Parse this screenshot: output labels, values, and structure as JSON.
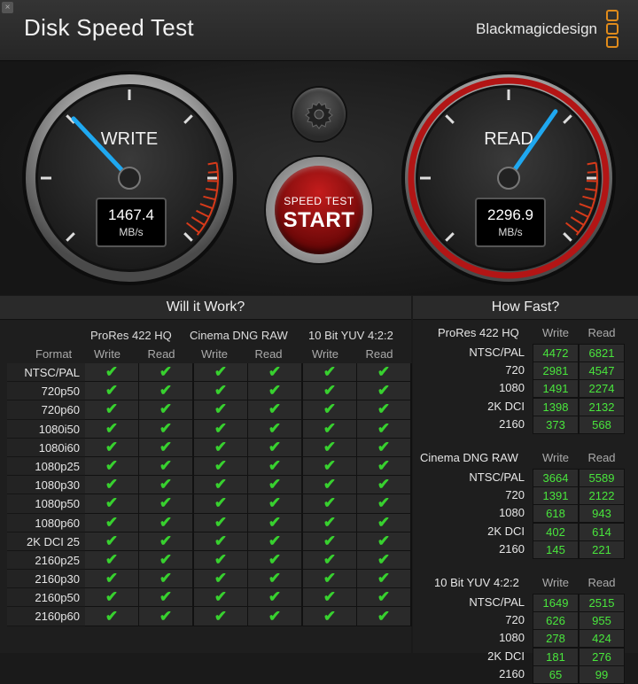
{
  "app": {
    "title": "Disk Speed Test",
    "brand": "Blackmagicdesign",
    "close_glyph": "×"
  },
  "gauges": {
    "write": {
      "label": "WRITE",
      "value": "1467.4",
      "unit": "MB/s",
      "needle_fraction": 0.34
    },
    "read": {
      "label": "READ",
      "value": "2296.9",
      "unit": "MB/s",
      "needle_fraction": 0.63
    }
  },
  "start_button": {
    "small": "SPEED TEST",
    "big": "START"
  },
  "icons": {
    "settings": "gear-icon",
    "check": "check-icon"
  },
  "colors": {
    "check": "#38d12f",
    "value": "#49e63c",
    "needle": "#1fa8f0",
    "read_ring": "#b31515",
    "redline": "#d63a1a",
    "brand_logo": "#e08b1b"
  },
  "will_it_work": {
    "title": "Will it Work?",
    "format_label": "Format",
    "groups": [
      "ProRes 422 HQ",
      "Cinema DNG RAW",
      "10 Bit YUV 4:2:2"
    ],
    "sub_headers": [
      "Write",
      "Read",
      "Write",
      "Read",
      "Write",
      "Read"
    ],
    "check_glyph": "✔",
    "rows": [
      "NTSC/PAL",
      "720p50",
      "720p60",
      "1080i50",
      "1080i60",
      "1080p25",
      "1080p30",
      "1080p50",
      "1080p60",
      "2K DCI 25",
      "2160p25",
      "2160p30",
      "2160p50",
      "2160p60"
    ]
  },
  "how_fast": {
    "title": "How Fast?",
    "groups": [
      {
        "name": "ProRes 422 HQ",
        "write_label": "Write",
        "read_label": "Read",
        "rows": [
          {
            "label": "NTSC/PAL",
            "write": "4472",
            "read": "6821"
          },
          {
            "label": "720",
            "write": "2981",
            "read": "4547"
          },
          {
            "label": "1080",
            "write": "1491",
            "read": "2274"
          },
          {
            "label": "2K DCI",
            "write": "1398",
            "read": "2132"
          },
          {
            "label": "2160",
            "write": "373",
            "read": "568"
          }
        ]
      },
      {
        "name": "Cinema DNG RAW",
        "write_label": "Write",
        "read_label": "Read",
        "rows": [
          {
            "label": "NTSC/PAL",
            "write": "3664",
            "read": "5589"
          },
          {
            "label": "720",
            "write": "1391",
            "read": "2122"
          },
          {
            "label": "1080",
            "write": "618",
            "read": "943"
          },
          {
            "label": "2K DCI",
            "write": "402",
            "read": "614"
          },
          {
            "label": "2160",
            "write": "145",
            "read": "221"
          }
        ]
      },
      {
        "name": "10 Bit YUV 4:2:2",
        "write_label": "Write",
        "read_label": "Read",
        "rows": [
          {
            "label": "NTSC/PAL",
            "write": "1649",
            "read": "2515"
          },
          {
            "label": "720",
            "write": "626",
            "read": "955"
          },
          {
            "label": "1080",
            "write": "278",
            "read": "424"
          },
          {
            "label": "2K DCI",
            "write": "181",
            "read": "276"
          },
          {
            "label": "2160",
            "write": "65",
            "read": "99"
          }
        ]
      }
    ]
  }
}
